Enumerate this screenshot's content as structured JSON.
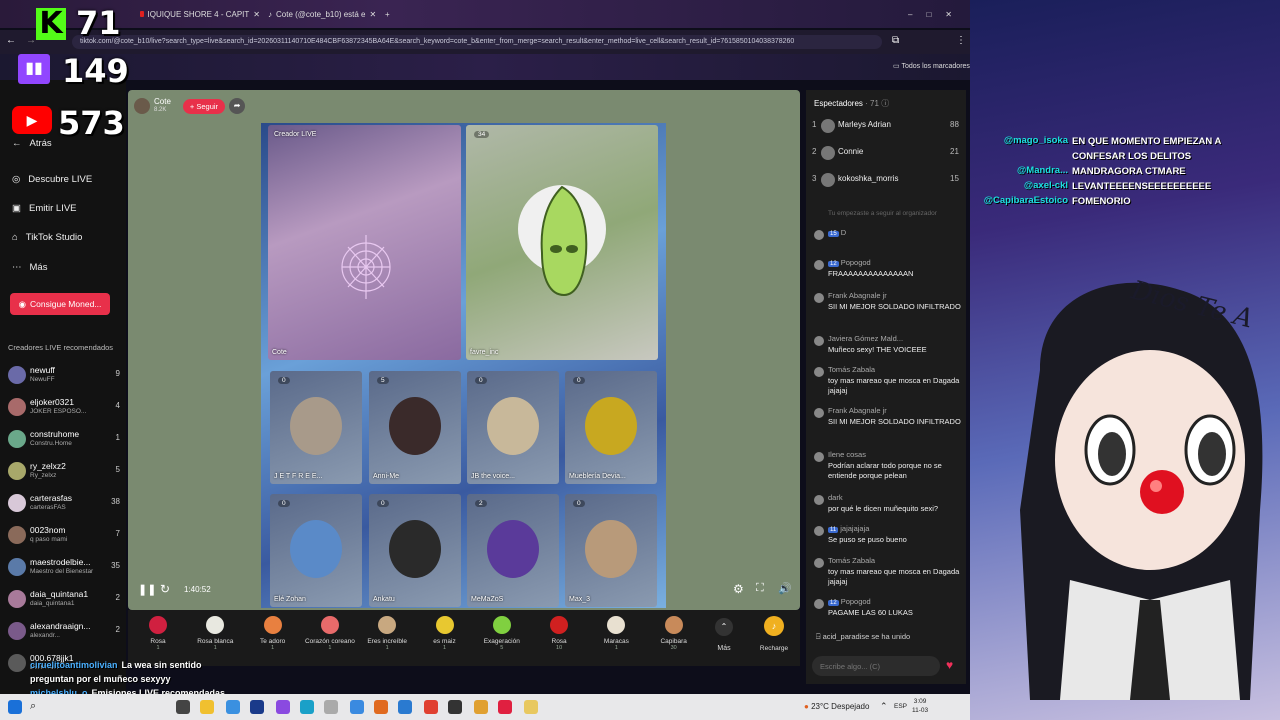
{
  "overlay": {
    "kick_count": "71",
    "twitch_count": "149",
    "youtube_count": "573",
    "bottom_chat": [
      {
        "user": "ciruelitoantimolivian",
        "text": "La wea sin sentido"
      },
      {
        "user": "",
        "text": "preguntan por el muñeco sexyyy"
      },
      {
        "user": "michelshlu_o",
        "text": "Emisiones LIVE recomendadas"
      }
    ],
    "right_chat": [
      {
        "user": "@mago_isoka",
        "text": "EN QUE MOMENTO EMPIEZAN A"
      },
      {
        "user": "",
        "text": "CONFESAR LOS DELITOS"
      },
      {
        "user": "@Mandra...",
        "text": "MANDRAGORA CTMARE"
      },
      {
        "user": "@axel-ckl",
        "text": "LEVANTEEEENSEEEEEEEEEE"
      },
      {
        "user": "@CapibaraEstoico",
        "text": "FOMENORIO"
      }
    ],
    "vtuber_sign": "Dios Te A"
  },
  "browser": {
    "tabs": [
      {
        "label": "IQUIQUE SHORE 4 - CAPIT"
      },
      {
        "label": "Cote (@cote_b10) está e"
      }
    ],
    "url": "tiktok.com/@cote_b10/live?search_type=live&search_id=20260311140710E484CBF63872345BA64E&search_keyword=cote_b&enter_from_merge=search_result&enter_method=live_cell&search_result_id=7615850104038378260",
    "bookmarks_label": "Todos los marcadores"
  },
  "sidebar": {
    "logo": "TikTok",
    "back_label": "Atrás",
    "nav": [
      {
        "label": "Descubre LIVE",
        "icon": "compass-icon"
      },
      {
        "label": "Emitir LIVE",
        "icon": "camera-icon"
      },
      {
        "label": "TikTok Studio",
        "icon": "studio-icon"
      },
      {
        "label": "Más",
        "icon": "more-icon"
      }
    ],
    "coins_button": "Consigue Moned...",
    "recommended_title": "Creadores LIVE recomendados",
    "creators": [
      {
        "name": "newuff",
        "sub": "NewuFF",
        "count": "9",
        "color": "#6a6aa8"
      },
      {
        "name": "eljoker0321",
        "sub": "JOKER ESPOSO...",
        "count": "4",
        "color": "#a86a6a"
      },
      {
        "name": "construhome",
        "sub": "Constru.Home",
        "count": "1",
        "color": "#6aa88a"
      },
      {
        "name": "ry_zelxz2",
        "sub": "Ry_zelxz",
        "count": "5",
        "color": "#a8a86a"
      },
      {
        "name": "carterasfas",
        "sub": "carterasFAS",
        "count": "38",
        "color": "#d8c8d8"
      },
      {
        "name": "0023nom",
        "sub": "q paso mami",
        "count": "7",
        "color": "#8a6a5a"
      },
      {
        "name": "maestrodelbie...",
        "sub": "Maestro del Bienestar",
        "count": "35",
        "color": "#5a7aa8"
      },
      {
        "name": "daia_quintana1",
        "sub": "daia_quintana1",
        "count": "2",
        "color": "#a87a9a"
      },
      {
        "name": "alexandraaign...",
        "sub": "alexandr...",
        "count": "2",
        "color": "#7a5a8a"
      },
      {
        "name": "000.678jjk1",
        "sub": "Darmnat...",
        "count": "",
        "color": "#5a5a5a"
      }
    ]
  },
  "live": {
    "host_name": "Cote",
    "host_likes": "8.2K",
    "follow_label": "+ Seguir",
    "creator_live_label": "Creador LIVE",
    "host_tile_label": "Cote",
    "guest_top_label": "favre_inc",
    "guest_top_badge": "34",
    "guests": [
      {
        "name": "J E T F R E E...",
        "badge": "0",
        "color": "#a89a8a"
      },
      {
        "name": "Anni-Me",
        "badge": "5",
        "color": "#3a2a2a"
      },
      {
        "name": "JB the voice...",
        "badge": "0",
        "color": "#c8b89a"
      },
      {
        "name": "Mueblería Devia...",
        "badge": "0",
        "color": "#c8a820"
      },
      {
        "name": "Elé Zohan",
        "badge": "0",
        "color": "#5a8ac8"
      },
      {
        "name": "Ankatu",
        "badge": "0",
        "color": "#2a2a2a"
      },
      {
        "name": "MeMaZoS",
        "badge": "2",
        "color": "#5a3a9a"
      },
      {
        "name": "Max_3",
        "badge": "0",
        "color": "#b89a7a"
      }
    ],
    "elapsed": "1:40:52"
  },
  "gifts": [
    {
      "name": "Rosa",
      "price": "1",
      "color": "#d02040"
    },
    {
      "name": "Rosa blanca",
      "price": "1",
      "color": "#e8e8e0"
    },
    {
      "name": "Te adoro",
      "price": "1",
      "color": "#e88040"
    },
    {
      "name": "Corazón coreano",
      "price": "1",
      "color": "#e86a6a"
    },
    {
      "name": "Eres increíble",
      "price": "1",
      "color": "#c8a880"
    },
    {
      "name": "es maiz",
      "price": "1",
      "color": "#e8c830"
    },
    {
      "name": "Exageración",
      "price": "5",
      "color": "#80d040"
    },
    {
      "name": "Rosa",
      "price": "10",
      "color": "#d02020"
    },
    {
      "name": "Maracas",
      "price": "1",
      "color": "#e8e0d0"
    },
    {
      "name": "Capibara",
      "price": "30",
      "color": "#c88a5a"
    }
  ],
  "gift_more": "Más",
  "recharge": "Recharge",
  "chat": {
    "viewers_title": "Espectadores",
    "viewers_count": "71",
    "top_viewers": [
      {
        "rank": "1",
        "name": "Marleys Adrian",
        "score": "88"
      },
      {
        "rank": "2",
        "name": "Connie",
        "score": "21"
      },
      {
        "rank": "3",
        "name": "kokoshka_morris",
        "score": "15"
      }
    ],
    "system_msg": "Tu empezaste a seguir al organizador",
    "messages": [
      {
        "user": "D",
        "level": "15",
        "text": ""
      },
      {
        "user": "Popogod",
        "level": "12",
        "text": "FRAAAAAAAAAAAAAAN"
      },
      {
        "user": "Frank Abagnale jr",
        "level": "",
        "text": "SII MI MEJOR SOLDADO INFILTRADO"
      },
      {
        "user": "Javiera Gómez Mald...",
        "level": "",
        "text": "Muñeco sexy! THE VOICEEE"
      },
      {
        "user": "Tomás Zabala",
        "level": "",
        "text": "toy mas mareao que mosca en Dagada jajajaj"
      },
      {
        "user": "Frank Abagnale jr",
        "level": "",
        "text": "SII MI MEJOR SOLDADO INFILTRADO"
      },
      {
        "user": "Ilene cosas",
        "level": "",
        "text": "Podrían aclarar todo porque no se entiende porque pelean"
      },
      {
        "user": "dark",
        "level": "",
        "text": "por qué le dicen muñequito sexi?"
      },
      {
        "user": "jajajajaja",
        "level": "11",
        "text": "Se puso se puso bueno"
      },
      {
        "user": "Tomás Zabala",
        "level": "",
        "text": "toy mas mareao que mosca en Dagada jajajaj"
      },
      {
        "user": "Popogod",
        "level": "12",
        "text": "PAGAME LAS 60 LUKAS"
      }
    ],
    "join_msg": "acid_paradise se ha unido",
    "input_placeholder": "Escribe algo... (C)"
  },
  "taskbar": {
    "weather": "23°C Despejado",
    "lang": "ESP",
    "time": "3:09",
    "date": "11-03"
  }
}
